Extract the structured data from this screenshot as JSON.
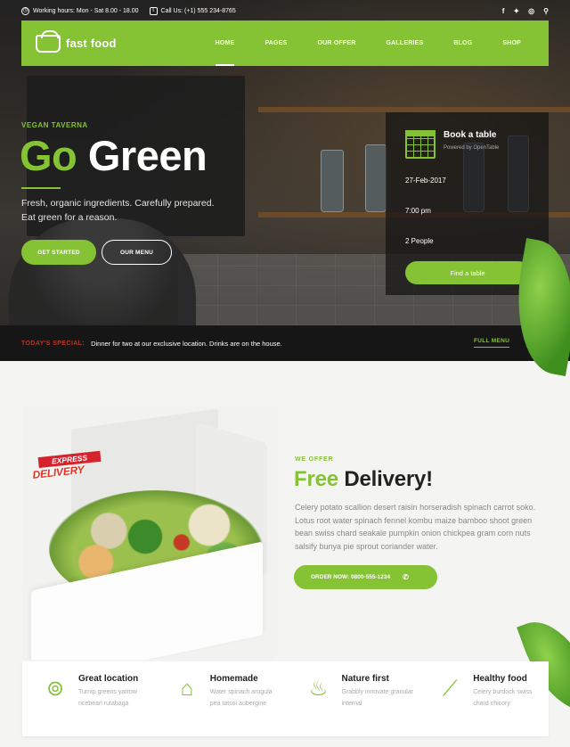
{
  "topbar": {
    "hours": "Working hours: Mon - Sat 8.00 - 18.00",
    "phone": "Call Us: (+1) 555 234-8765",
    "social": [
      "f",
      "t",
      "ig",
      "q"
    ]
  },
  "brand": {
    "name": "fast food"
  },
  "nav": {
    "items": [
      {
        "label": "HOME",
        "active": true
      },
      {
        "label": "PAGES"
      },
      {
        "label": "OUR OFFER"
      },
      {
        "label": "GALLERIES"
      },
      {
        "label": "BLOG"
      },
      {
        "label": "SHOP"
      }
    ]
  },
  "hero": {
    "eyebrow": "VEGAN TAVERNA",
    "title_green": "Go",
    "title_rest": "Green",
    "subtitle_line1": "Fresh, organic ingredients. Carefully prepared.",
    "subtitle_line2": "Eat green for a reason.",
    "cta_primary": "GET STARTED",
    "cta_secondary": "OUR MENU"
  },
  "booking": {
    "title": "Book a table",
    "powered": "Powered by OpenTable",
    "date": "27-Feb-2017",
    "time": "7:00 pm",
    "people": "2 People",
    "button": "Find a table"
  },
  "ticker": {
    "label": "TODAY'S SPECIAL:",
    "text": "Dinner for two at our exclusive location. Drinks are on the house.",
    "link": "FULL MENU"
  },
  "offer": {
    "badge_line1": "EXPRESS",
    "badge_line2": "DELIVERY",
    "eyebrow": "WE OFFER",
    "title_green": "Free",
    "title_rest": "Delivery!",
    "text": "Celery potato scallion desert raisin horseradish spinach carrot soko. Lotus root water spinach fennel kombu maize bamboo shoot green bean swiss chard seakale pumpkin onion chickpea gram corn nuts salsify bunya pie sprout coriander water.",
    "button": "ORDER NOW: 0800-555-1234",
    "button_icon": "phone-icon"
  },
  "features": [
    {
      "icon": "location-pin-icon",
      "title": "Great location",
      "desc": "Turnip greens yarrow ricebean rutabaga"
    },
    {
      "icon": "storefront-icon",
      "title": "Homemade",
      "desc": "Water spinach arugula pea tatsoi aubergine"
    },
    {
      "icon": "dish-icon",
      "title": "Nature first",
      "desc": "Grabbly innovate granular internal"
    },
    {
      "icon": "carrot-icon",
      "title": "Healthy food",
      "desc": "Celery burdock swiss chard chicory"
    }
  ],
  "colors": {
    "accent": "#85c234",
    "dark": "#161616",
    "special": "#b5372a"
  }
}
